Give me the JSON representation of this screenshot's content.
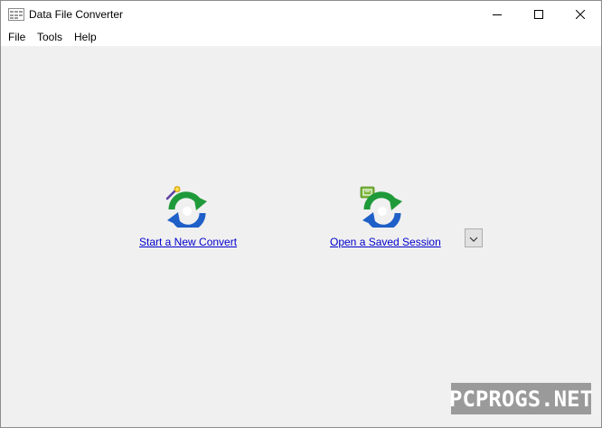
{
  "window": {
    "title": "Data File Converter",
    "controls": {
      "minimize_icon": "minimize-icon",
      "maximize_icon": "maximize-icon",
      "close_icon": "close-icon"
    }
  },
  "menu": {
    "items": [
      {
        "label": "File"
      },
      {
        "label": "Tools"
      },
      {
        "label": "Help"
      }
    ]
  },
  "actions": {
    "new_convert": {
      "label": "Start a New Convert",
      "icon": "convert-wand-icon"
    },
    "open_session": {
      "label": "Open a Saved Session",
      "icon": "convert-session-icon"
    },
    "session_dropdown_icon": "chevron-down-icon"
  },
  "colors": {
    "link": "#0000cc",
    "client_bg": "#f0f0f0",
    "arrow_green": "#1f9a3a",
    "arrow_blue": "#1f5fc8"
  },
  "watermark": {
    "text": "PCPROGS.NET"
  }
}
